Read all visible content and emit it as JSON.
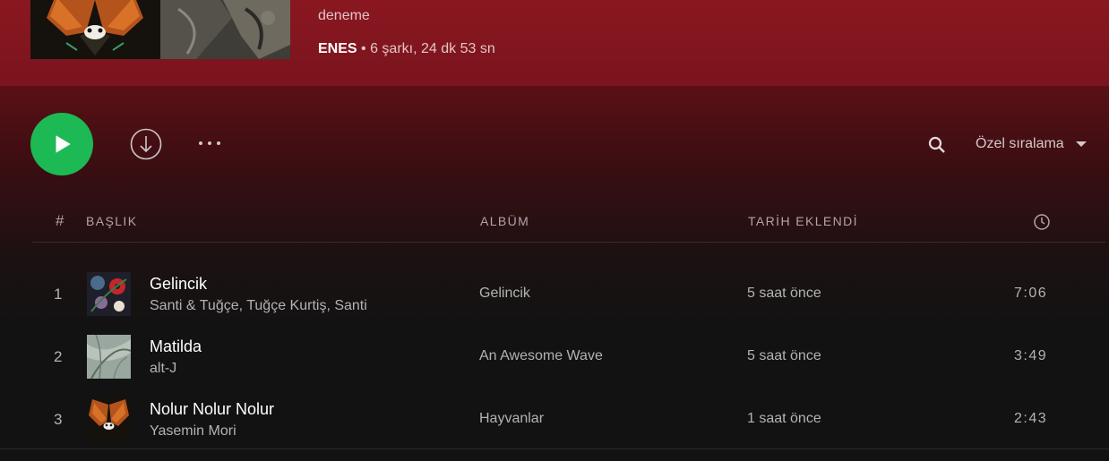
{
  "playlist": {
    "description": "deneme",
    "owner": "ENES",
    "separator": " • ",
    "stats": "6 şarkı, 24 dk 53 sn",
    "cover_icons": [
      "butterfly-art",
      "rock-texture-art"
    ]
  },
  "controls": {
    "play_icon": "play-icon",
    "download_icon": "download-icon",
    "more_icon": "more-icon",
    "search_icon": "search-icon",
    "sort_label": "Özel sıralama",
    "sort_icon": "caret-down-icon"
  },
  "table": {
    "headers": {
      "num": "#",
      "title": "BAŞLIK",
      "album": "ALBÜM",
      "date_added": "TARİH EKLENDİ",
      "duration_icon": "clock-icon"
    },
    "rows": [
      {
        "index": "1",
        "title": "Gelincik",
        "artist": "Santi & Tuğçe, Tuğçe Kurtiş, Santi",
        "album": "Gelincik",
        "added": "5 saat önce",
        "duration": "7:06"
      },
      {
        "index": "2",
        "title": "Matilda",
        "artist": "alt-J",
        "album": "An Awesome Wave",
        "added": "5 saat önce",
        "duration": "3:49"
      },
      {
        "index": "3",
        "title": "Nolur Nolur Nolur",
        "artist": "Yasemin Mori",
        "album": "Hayvanlar",
        "added": "1 saat önce",
        "duration": "2:43"
      }
    ]
  },
  "colors": {
    "accent": "#1db954",
    "header_bg": "#8a1720",
    "page_bg": "#121212"
  }
}
